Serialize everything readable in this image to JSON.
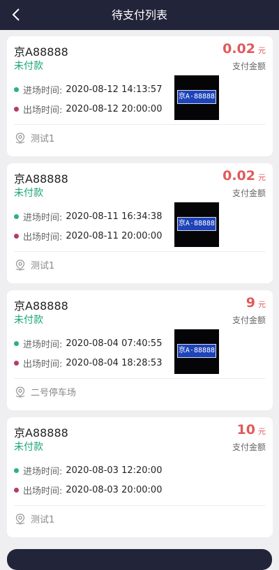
{
  "header": {
    "title": "待支付列表",
    "back_icon": "chevron-left-icon"
  },
  "colors": {
    "header_bg": "#22243a",
    "amount": "#e05a5a",
    "status": "#1aa37a",
    "entry_dot": "#2bb183",
    "exit_dot": "#b63b66"
  },
  "records": [
    {
      "plate": "京A88888",
      "status": "未付款",
      "amount": "0.02",
      "unit": "元",
      "amount_label": "支付金额",
      "entry_label": "进场时间:",
      "entry_time": "2020-08-12 14:13:57",
      "exit_label": "出场时间:",
      "exit_time": "2020-08-12 20:00:00",
      "location": "测试1",
      "photo_plate_text": "京A·88888"
    },
    {
      "plate": "京A88888",
      "status": "未付款",
      "amount": "0.02",
      "unit": "元",
      "amount_label": "支付金额",
      "entry_label": "进场时间:",
      "entry_time": "2020-08-11 16:34:38",
      "exit_label": "出场时间:",
      "exit_time": "2020-08-11 20:00:00",
      "location": "测试1",
      "photo_plate_text": "京A·88888"
    },
    {
      "plate": "京A88888",
      "status": "未付款",
      "amount": "9",
      "unit": "元",
      "amount_label": "支付金额",
      "entry_label": "进场时间:",
      "entry_time": "2020-08-04 07:40:55",
      "exit_label": "出场时间:",
      "exit_time": "2020-08-04 18:28:53",
      "location": "二号停车场",
      "photo_plate_text": "京A·88888"
    },
    {
      "plate": "京A88888",
      "status": "未付款",
      "amount": "10",
      "unit": "元",
      "amount_label": "支付金额",
      "entry_label": "进场时间:",
      "entry_time": "2020-08-03 12:20:00",
      "exit_label": "出场时间:",
      "exit_time": "2020-08-03 20:00:00",
      "location": "测试1"
    }
  ]
}
